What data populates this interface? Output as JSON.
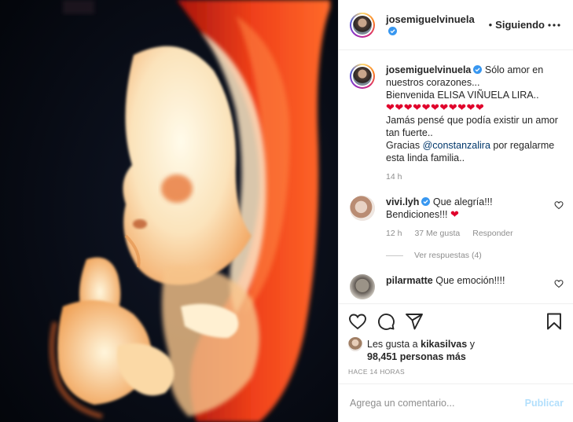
{
  "header": {
    "username": "josemiguelvinuela",
    "separator": "•",
    "follow_status": "Siguiendo",
    "more_icon": "more-horizontal-icon"
  },
  "caption": {
    "username": "josemiguelvinuela",
    "line1": "Sólo amor en nuestros corazones...",
    "line2": "Bienvenida ELISA VIÑUELA LIRA..",
    "hearts": "❤❤❤❤❤❤❤❤❤❤❤",
    "line3": "Jamás pensé que podía existir un amor tan fuerte..",
    "thanks_prefix": "Gracias",
    "mention": "@constanzalira",
    "thanks_suffix": "por regalarme esta linda familia..",
    "time": "14 h"
  },
  "comments": [
    {
      "username": "vivi.lyh",
      "text": "Que alegría!!! Bendiciones!!!",
      "heart": "❤",
      "time": "12 h",
      "likes": "37 Me gusta",
      "reply_label": "Responder",
      "view_replies": "Ver respuestas (4)"
    },
    {
      "username": "pilarmatte",
      "text": "Que emoción!!!!"
    }
  ],
  "likes": {
    "prefix": "Les gusta a",
    "user": "kikasilvas",
    "middle": "y",
    "count": "98,451 personas más"
  },
  "posted_ago": "HACE 14 HORAS",
  "add_comment": {
    "placeholder": "Agrega un comentario...",
    "publish_label": "Publicar"
  },
  "colors": {
    "verified": "#3897f0",
    "heart": "#e0002b",
    "link": "#00376b",
    "publish_disabled": "#b2dffc",
    "secondary_text": "#8e8e8e"
  },
  "icons": [
    "verified-badge-icon",
    "like-heart-icon",
    "comment-icon",
    "share-icon",
    "bookmark-icon",
    "comment-like-heart-icon"
  ]
}
